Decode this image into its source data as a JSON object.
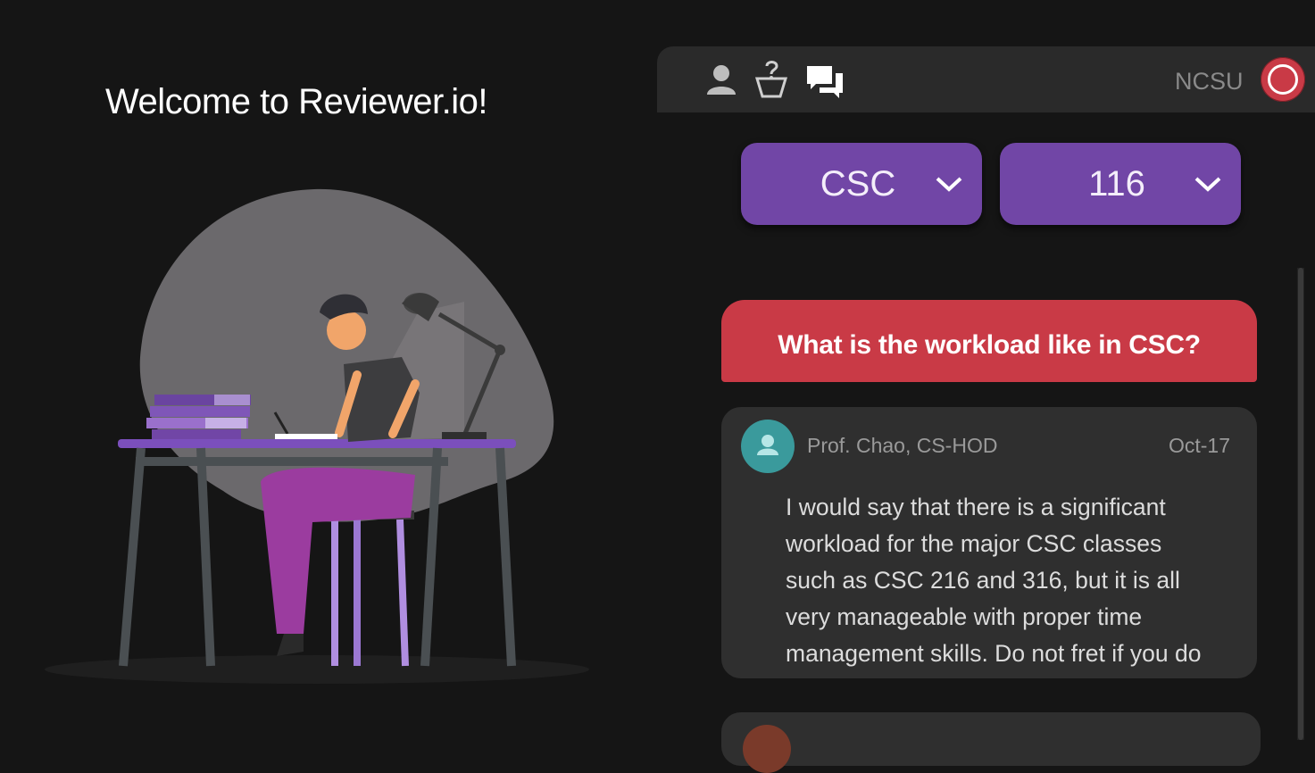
{
  "welcome": {
    "title": "Welcome to Reviewer.io!"
  },
  "topbar": {
    "icons": [
      "user-icon",
      "question-icon",
      "chat-icon"
    ],
    "school": "NCSU",
    "power_color": "#c93a46"
  },
  "filters": {
    "department": "CSC",
    "course_number": "116"
  },
  "question": {
    "text": "What is the workload like in CSC?"
  },
  "answers": [
    {
      "author": "Prof. Chao, CS-HOD",
      "date": "Oct-17",
      "text": "I would say that there is a significant\nworkload for the major CSC classes\nsuch as CSC 216 and 316, but it is all\nvery manageable with proper time\nmanagement skills. Do not fret if you do",
      "avatar_color": "#3a9a9c"
    }
  ],
  "colors": {
    "accent_purple": "#7146a6",
    "accent_red": "#c93a46",
    "background": "#151515"
  }
}
